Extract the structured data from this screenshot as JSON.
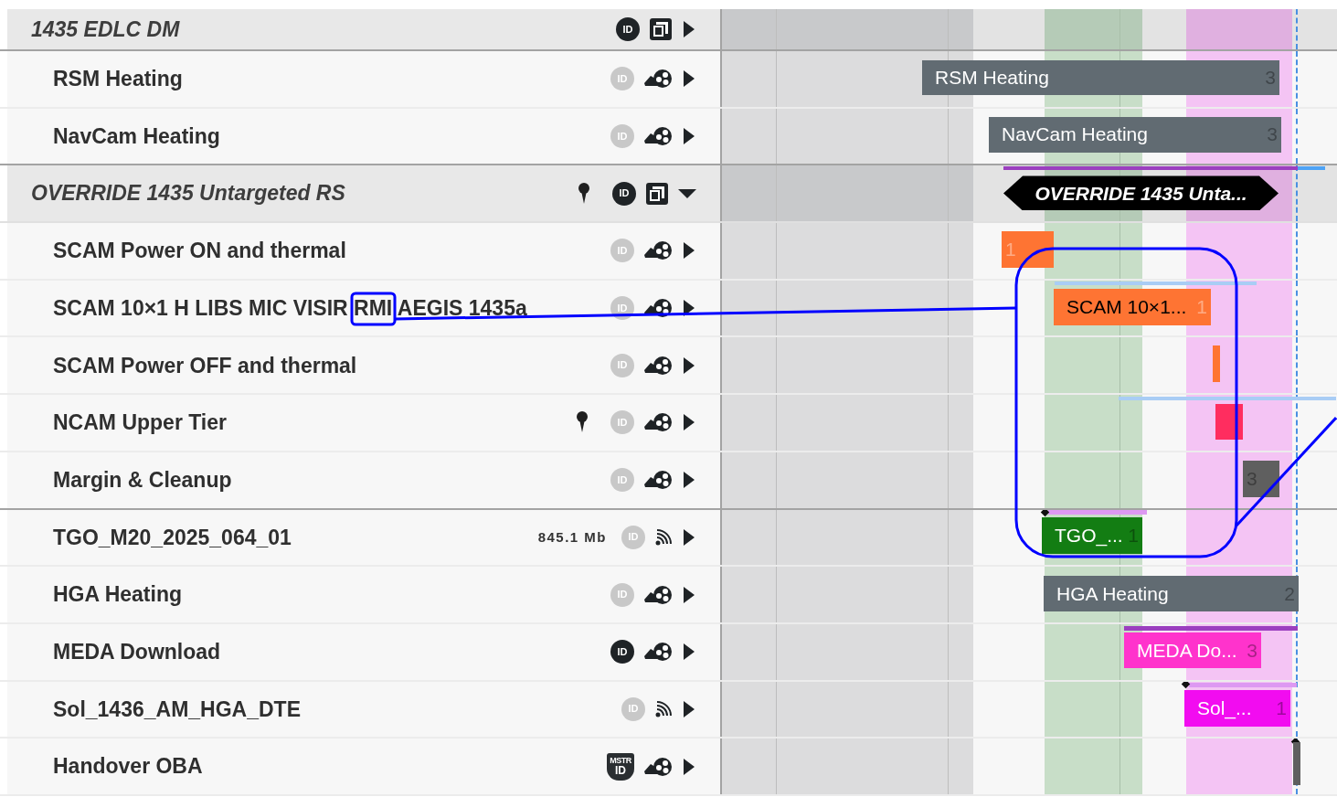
{
  "rows": [
    {
      "kind": "group",
      "label": "1435 EDLC DM",
      "pin": false,
      "badge": {
        "kind": "id",
        "active": true,
        "text": "ID"
      },
      "expanded": false
    },
    {
      "kind": "activity",
      "label": "RSM Heating",
      "pin": false,
      "badge": {
        "kind": "id",
        "active": false,
        "text": "ID"
      },
      "expanded": false,
      "bars": [
        {
          "kind": "bar",
          "label": "RSM Heating",
          "count": "3",
          "color": "#616b72"
        }
      ]
    },
    {
      "kind": "activity",
      "label": "NavCam Heating",
      "pin": false,
      "badge": {
        "kind": "id",
        "active": false,
        "text": "ID"
      },
      "expanded": false,
      "bars": [
        {
          "kind": "bar",
          "label": "NavCam Heating",
          "count": "3",
          "color": "#616b72"
        }
      ]
    },
    {
      "kind": "group",
      "label": "OVERRIDE 1435 Untargeted RS",
      "pin": true,
      "badge": {
        "kind": "id",
        "active": true,
        "text": "ID"
      },
      "expanded": true,
      "bars": [
        {
          "kind": "line",
          "color": "#9b3fbf"
        },
        {
          "kind": "line",
          "color": "#4ea3f5"
        },
        {
          "kind": "hex",
          "label": "OVERRIDE 1435 Unta...",
          "color": "#000000"
        }
      ]
    },
    {
      "kind": "activity",
      "label": "SCAM Power ON and thermal",
      "pin": false,
      "badge": {
        "kind": "id",
        "active": false,
        "text": "ID"
      },
      "expanded": false,
      "bars": [
        {
          "kind": "bar",
          "count": "1",
          "color": "#fe7433"
        }
      ]
    },
    {
      "kind": "activity",
      "label": "SCAM 10×1 H LIBS MIC VISIR RMI AEGIS 1435a",
      "pin": false,
      "badge": {
        "kind": "id",
        "active": false,
        "text": "ID"
      },
      "expanded": false,
      "bars": [
        {
          "kind": "line",
          "color": "#a9cdf5"
        },
        {
          "kind": "bar",
          "label": "SCAM 10×1...",
          "count": "1",
          "color": "#fe7433"
        }
      ]
    },
    {
      "kind": "activity",
      "label": "SCAM Power OFF and thermal",
      "pin": false,
      "badge": {
        "kind": "id",
        "active": false,
        "text": "ID"
      },
      "expanded": false,
      "bars": [
        {
          "kind": "bar",
          "color": "#fe7433"
        }
      ]
    },
    {
      "kind": "activity",
      "label": "NCAM Upper Tier",
      "pin": true,
      "badge": {
        "kind": "id",
        "active": false,
        "text": "ID"
      },
      "expanded": false,
      "bars": [
        {
          "kind": "line",
          "color": "#a9cdf5"
        },
        {
          "kind": "bar",
          "color": "#ff2d5f"
        }
      ]
    },
    {
      "kind": "activity",
      "label": "Margin & Cleanup",
      "pin": false,
      "badge": {
        "kind": "id",
        "active": false,
        "text": "ID"
      },
      "expanded": false,
      "bars": [
        {
          "kind": "bar",
          "count": "3",
          "color": "#5f5f5f"
        }
      ]
    },
    {
      "kind": "downlink",
      "label": "TGO_M20_2025_064_01",
      "size": "845.1 Mb",
      "pin": false,
      "badge": {
        "kind": "id",
        "active": false,
        "text": "ID"
      },
      "expanded": false,
      "bars": [
        {
          "kind": "line",
          "color": "#dd99f2"
        },
        {
          "kind": "diamond",
          "color": "#111111"
        },
        {
          "kind": "bar",
          "label": "TGO_...",
          "count": "1",
          "color": "#137d13"
        }
      ]
    },
    {
      "kind": "activity",
      "label": "HGA Heating",
      "pin": false,
      "badge": {
        "kind": "id",
        "active": false,
        "text": "ID"
      },
      "expanded": false,
      "bars": [
        {
          "kind": "bar",
          "label": "HGA Heating",
          "count": "2",
          "color": "#616b72"
        }
      ]
    },
    {
      "kind": "activity",
      "label": "MEDA Download",
      "pin": false,
      "badge": {
        "kind": "id",
        "active": true,
        "text": "ID"
      },
      "expanded": false,
      "bars": [
        {
          "kind": "line",
          "color": "#9b3fbf"
        },
        {
          "kind": "bar",
          "label": "MEDA Do...",
          "count": "3",
          "color": "#ff33cc"
        }
      ]
    },
    {
      "kind": "downlink",
      "label": "Sol_1436_AM_HGA_DTE",
      "pin": false,
      "badge": {
        "kind": "id",
        "active": false,
        "text": "ID"
      },
      "expanded": false,
      "bars": [
        {
          "kind": "line",
          "color": "#dd99f2"
        },
        {
          "kind": "diamond",
          "color": "#111111"
        },
        {
          "kind": "bar",
          "label": "Sol_...",
          "count": "1",
          "color": "#f20cf0"
        }
      ]
    },
    {
      "kind": "activity",
      "label": "Handover OBA",
      "pin": false,
      "badge": {
        "kind": "master",
        "active": true,
        "top": "MSTR",
        "text": "ID"
      },
      "expanded": false,
      "bars": [
        {
          "kind": "diamond",
          "color": "#111111"
        },
        {
          "kind": "bar",
          "color": "#5f5f5f"
        }
      ]
    }
  ]
}
